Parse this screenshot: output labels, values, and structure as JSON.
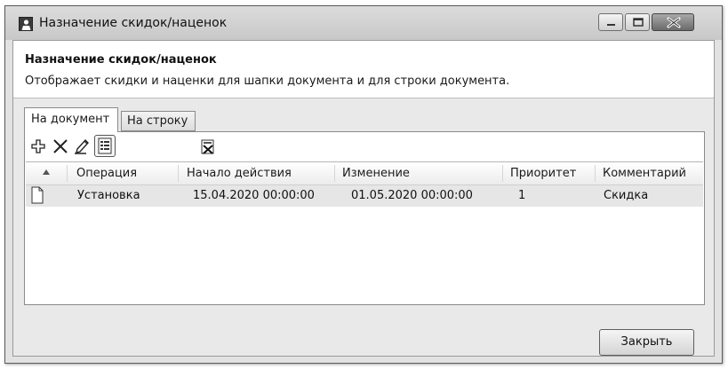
{
  "window": {
    "title": "Назначение скидок/наценок"
  },
  "header": {
    "title": "Назначение скидок/наценок",
    "description": "Отображает скидки и наценки для шапки документа и для строки документа."
  },
  "tabs": [
    {
      "label": "На документ",
      "active": true
    },
    {
      "label": "На строку",
      "active": false
    }
  ],
  "toolbar": {
    "icons": [
      "add-icon",
      "delete-icon",
      "edit-icon",
      "filter-icon",
      "clear-filter-icon"
    ]
  },
  "grid": {
    "columns": [
      "Операция",
      "Начало действия",
      "Изменение",
      "Приоритет",
      "Комментарий"
    ],
    "sort_column": "Операция",
    "rows": [
      {
        "operation": "Установка",
        "start": "15.04.2020 00:00:00",
        "changed": "01.05.2020 00:00:00",
        "priority": "1",
        "comment": "Скидка"
      }
    ]
  },
  "footer": {
    "close_label": "Закрыть"
  },
  "colors": {
    "selected_row": "#e6e6e6",
    "window_frame": "#e2e2e2",
    "header_pane": "#ffffff"
  }
}
